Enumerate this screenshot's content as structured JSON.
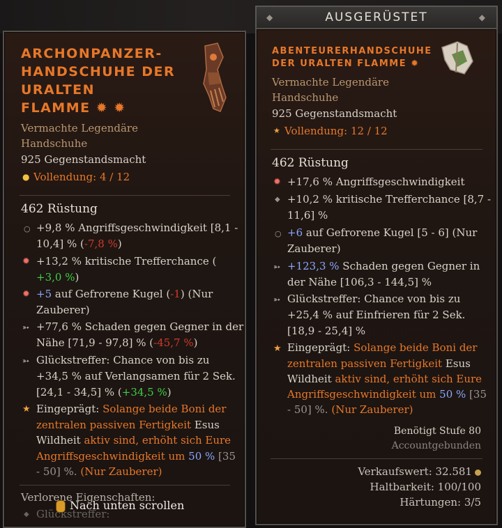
{
  "right_header": "AUSGERÜSTET",
  "left": {
    "title_lines": [
      "ARCHONPANZER-",
      "HANDSCHUHE DER",
      "URALTEN",
      "FLAMME ✹ ✹"
    ],
    "type_lines": [
      "Vermachte Legendäre",
      "Handschuhe"
    ],
    "item_power": "925 Gegenstandsmacht",
    "mastery": "Vollendung: 4 / 12",
    "armor": "462 Rüstung",
    "affixes": [
      {
        "l1": "+9,8 % Angriffsgeschwindigkeit [8,1 -",
        "l2a": "10,4] % (",
        "l2b": "-7,8 %",
        "l2c": ")"
      },
      {
        "l1": "+13,2 % kritische Trefferchance (",
        "l2a": "",
        "l2b": "+3,0 %",
        "l2c": ")"
      },
      {
        "l1a": "+5",
        "l1b": " auf Gefrorene Kugel (",
        "l1c": "-1",
        "l1d": ") (Nur",
        "l2": "Zauberer)"
      },
      {
        "l1": "+77,6 % Schaden gegen Gegner in der",
        "l2a": "Nähe [71,9 - 97,8] % (",
        "l2b": "-45,7 %",
        "l2c": ")"
      },
      {
        "l1": "Glückstreffer: Chance von bis zu",
        "l2": "+34,5 % auf Verlangsamen für 2 Sek.",
        "l3a": "[24,1 - 34,5] % (",
        "l3b": "+34,5 %",
        "l3c": ")"
      }
    ],
    "aspect": {
      "a1": "Eingeprägt: ",
      "a2": "Solange beide Boni der",
      "a3": "zentralen passiven Fertigkeit",
      "a4": " Esus",
      "a5": "Wildheit",
      "a6": " aktiv sind, erhöht sich Eure",
      "a7": "Angriffsgeschwindigkeit um ",
      "a8": "50 %",
      "a9": " [35",
      "a10": "- 50] %. ",
      "a11": "(Nur Zauberer)"
    },
    "lost_props": "Verlorene Eigenschaften:",
    "lost_item": "Glückstreffer:",
    "scroll_hint": "Nach unten scrollen"
  },
  "right": {
    "title_lines": [
      "ABENTEURERHANDSCHUHE",
      "DER URALTEN FLAMME ✹"
    ],
    "type_lines": [
      "Vermachte Legendäre",
      "Handschuhe"
    ],
    "item_power": "925 Gegenstandsmacht",
    "mastery": "Vollendung: 12 / 12",
    "armor": "462 Rüstung",
    "affixes": [
      {
        "l1": "+17,6 % Angriffsgeschwindigkeit"
      },
      {
        "l1": "+10,2 % kritische Trefferchance [8,7 -",
        "l2": "11,6] %"
      },
      {
        "l1a": "+6",
        "l1b": " auf Gefrorene Kugel [5 - 6] (Nur",
        "l2": "Zauberer)"
      },
      {
        "l1a": "+123,3 %",
        "l1b": " Schaden gegen Gegner in",
        "l2": "der Nähe [106,3 - 144,5] %"
      },
      {
        "l1": "Glückstreffer: Chance von bis zu",
        "l2": "+25,4 % auf Einfrieren für 2 Sek.",
        "l3": "[18,9 - 25,4] %"
      }
    ],
    "aspect": {
      "a1": "Eingeprägt: ",
      "a2": "Solange beide Boni der",
      "a3": "zentralen passiven Fertigkeit",
      "a4": " Esus",
      "a5": "Wildheit",
      "a6": " aktiv sind, erhöht sich Eure",
      "a7": "Angriffsgeschwindigkeit um ",
      "a8": "50 %",
      "a9": " [35",
      "a10": "- 50] %. ",
      "a11": "(Nur Zauberer)"
    },
    "required_level": "Benötigt Stufe 80",
    "account_bound": "Accountgebunden",
    "sell_value": "Verkaufswert: 32.581",
    "durability": "Haltbarkeit: 100/100",
    "tempers": "Härtungen: 3/5"
  }
}
